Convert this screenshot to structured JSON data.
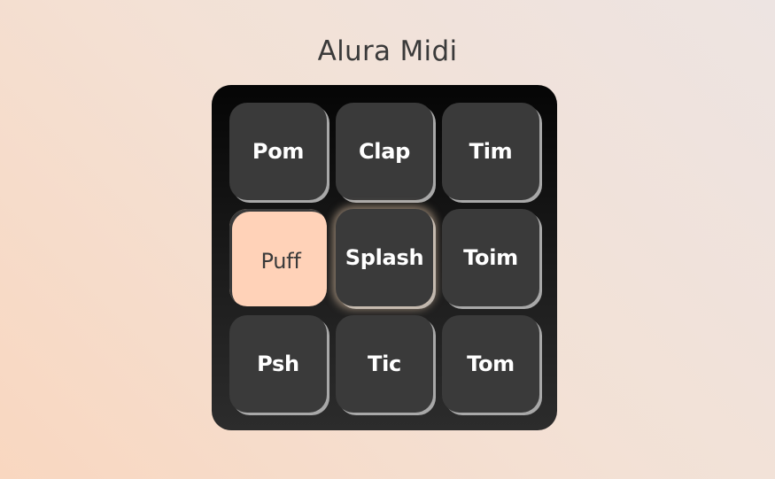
{
  "app": {
    "title": "Alura Midi"
  },
  "pads": [
    {
      "label": "Pom",
      "state": "normal"
    },
    {
      "label": "Clap",
      "state": "normal"
    },
    {
      "label": "Tim",
      "state": "normal"
    },
    {
      "label": "Puff",
      "state": "active"
    },
    {
      "label": "Splash",
      "state": "focused"
    },
    {
      "label": "Toim",
      "state": "normal"
    },
    {
      "label": "Psh",
      "state": "normal"
    },
    {
      "label": "Tic",
      "state": "normal"
    },
    {
      "label": "Tom",
      "state": "normal"
    }
  ],
  "colors": {
    "pad": "#3a3a3a",
    "pad_active": "#ffd2b8",
    "board": "#111111",
    "title_text": "#3a3a3a"
  }
}
